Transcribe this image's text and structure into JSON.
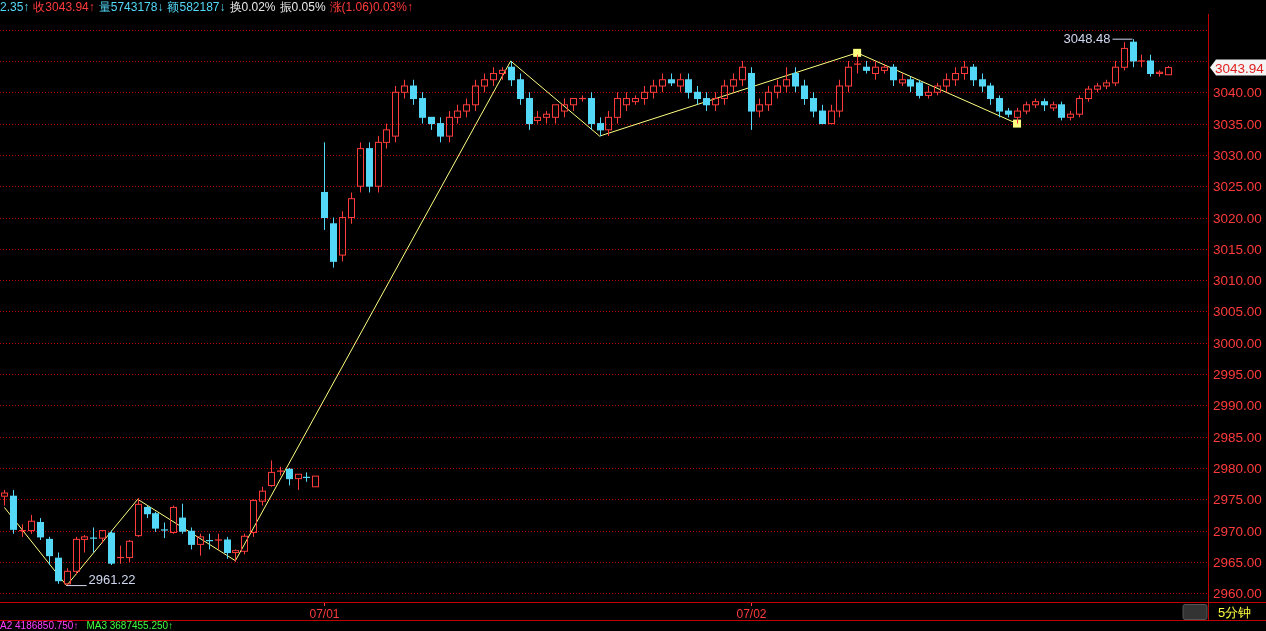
{
  "quote_bar": [
    {
      "text": "2.35↑",
      "color": "#54d8f8"
    },
    {
      "text": "收3043.94↑",
      "color": "#ff3b3b"
    },
    {
      "text": "量5743178↓",
      "color": "#54d8f8"
    },
    {
      "text": "额582187↓",
      "color": "#54d8f8"
    },
    {
      "text": "换0.02%",
      "color": "#e8e8e8"
    },
    {
      "text": "振0.05%",
      "color": "#e8e8e8"
    },
    {
      "text": "涨(1.06)0.03%↑",
      "color": "#ff3b3b"
    }
  ],
  "chart": {
    "period": "5分钟",
    "chart_data": {
      "type": "candlestick",
      "grid": true,
      "categories": [
        null,
        null,
        null,
        null,
        null,
        null,
        null,
        null,
        null,
        null,
        null,
        null,
        null,
        null,
        null,
        null,
        null,
        null,
        null,
        null,
        null,
        null,
        null,
        null,
        null,
        null,
        null,
        null,
        null,
        null,
        null,
        null,
        null,
        null,
        null,
        null,
        "07/01",
        null,
        null,
        null,
        null,
        null,
        null,
        null,
        null,
        null,
        null,
        null,
        null,
        null,
        null,
        null,
        null,
        null,
        null,
        null,
        null,
        null,
        null,
        null,
        null,
        null,
        null,
        null,
        null,
        null,
        null,
        null,
        null,
        null,
        null,
        null,
        null,
        null,
        null,
        null,
        null,
        null,
        null,
        null,
        null,
        null,
        null,
        null,
        "07/02",
        null,
        null,
        null,
        null,
        null,
        null,
        null,
        null,
        null,
        null,
        null,
        null,
        null,
        null,
        null,
        null,
        null,
        null,
        null,
        null,
        null,
        null,
        null,
        null,
        null,
        null,
        null,
        null,
        null,
        null,
        null,
        null,
        null,
        null,
        null,
        null,
        null,
        null,
        null,
        null,
        null,
        null,
        null,
        null,
        null,
        null,
        null,
        null,
        null,
        null,
        null
      ],
      "ylim": [
        2958.6,
        3052.5
      ],
      "yticks": [
        {
          "value": 3040,
          "label": "3040.00"
        },
        {
          "value": 3035,
          "label": "3035.00"
        },
        {
          "value": 3030,
          "label": "3030.00"
        },
        {
          "value": 3025,
          "label": "3025.00"
        },
        {
          "value": 3020,
          "label": "3020.00"
        },
        {
          "value": 3015,
          "label": "3015.00"
        },
        {
          "value": 3010,
          "label": "3010.00"
        },
        {
          "value": 3005,
          "label": "3005.00"
        },
        {
          "value": 3000,
          "label": "3000.00"
        },
        {
          "value": 2995,
          "label": "2995.00"
        },
        {
          "value": 2990,
          "label": "2990.00"
        },
        {
          "value": 2985,
          "label": "2985.00"
        },
        {
          "value": 2980,
          "label": "2980.00"
        },
        {
          "value": 2975,
          "label": "2975.00"
        },
        {
          "value": 2970,
          "label": "2970.00"
        },
        {
          "value": 2965,
          "label": "2965.00"
        },
        {
          "value": 2960,
          "label": "2960.00"
        }
      ],
      "ohlc": [
        [
          2975.5,
          2976.5,
          2974,
          2976
        ],
        [
          2975.5,
          2976.5,
          2969.5,
          2970.2
        ],
        [
          2970,
          2971,
          2969,
          2970
        ],
        [
          2970,
          2972.5,
          2969.5,
          2971.5
        ],
        [
          2971.3,
          2972,
          2968.5,
          2969
        ],
        [
          2968.6,
          2969,
          2964.5,
          2966
        ],
        [
          2965.6,
          2966.5,
          2961.5,
          2962
        ],
        [
          2961.5,
          2964,
          2961.22,
          2963.5
        ],
        [
          2963.5,
          2969,
          2963,
          2968.6
        ],
        [
          2968.6,
          2969.3,
          2966.5,
          2969
        ],
        [
          2968.8,
          2970.5,
          2966.5,
          2968.7
        ],
        [
          2968.8,
          2970,
          2968,
          2970
        ],
        [
          2969.6,
          2970,
          2964.5,
          2964.8
        ],
        [
          2965.7,
          2967.6,
          2964.7,
          2965.7
        ],
        [
          2965.7,
          2968.5,
          2965,
          2968.3
        ],
        [
          2969.2,
          2975.2,
          2969,
          2974.2
        ],
        [
          2973.7,
          2974,
          2972,
          2972.7
        ],
        [
          2972.7,
          2973,
          2969.8,
          2970.4
        ],
        [
          2970.1,
          2971.3,
          2968.8,
          2970
        ],
        [
          2969.7,
          2974,
          2969.5,
          2973.7
        ],
        [
          2972,
          2974.3,
          2969.5,
          2969.9
        ],
        [
          2969.9,
          2970.5,
          2967,
          2967.8
        ],
        [
          2967.8,
          2969.5,
          2966,
          2969
        ],
        [
          2968.4,
          2969.5,
          2967,
          2968.3
        ],
        [
          2968.5,
          2969.5,
          2967,
          2968.5
        ],
        [
          2968.5,
          2969,
          2965.5,
          2966.5
        ],
        [
          2966.5,
          2967,
          2965,
          2966.8
        ],
        [
          2966.7,
          2969.5,
          2966.2,
          2969.1
        ],
        [
          2969.7,
          2975,
          2969,
          2974.8
        ],
        [
          2974.7,
          2977,
          2974,
          2976.3
        ],
        [
          2977.2,
          2981.2,
          2977,
          2979.3
        ],
        [
          2979.5,
          2980.2,
          2978.8,
          2979.5
        ],
        [
          2979.8,
          2980,
          2977.2,
          2978.3
        ],
        [
          2978.3,
          2979,
          2976.5,
          2979
        ],
        [
          2978.5,
          2979.3,
          2977.8,
          2978.4
        ],
        [
          2977,
          2978.7,
          2977,
          2978.7
        ],
        [
          3024,
          3032,
          3018,
          3020
        ],
        [
          3019,
          3020,
          3012,
          3013
        ],
        [
          3014,
          3021,
          3013,
          3020
        ],
        [
          3020,
          3024,
          3019,
          3023
        ],
        [
          3025,
          3032,
          3024,
          3031
        ],
        [
          3031,
          3032,
          3024,
          3025
        ],
        [
          3025,
          3033,
          3024,
          3032
        ],
        [
          3032,
          3035,
          3031,
          3034
        ],
        [
          3033,
          3041,
          3032,
          3040
        ],
        [
          3040,
          3042,
          3039,
          3041
        ],
        [
          3041,
          3042,
          3038,
          3039
        ],
        [
          3039,
          3040,
          3035,
          3036
        ],
        [
          3036,
          3036,
          3034,
          3035
        ],
        [
          3035,
          3036,
          3032,
          3033
        ],
        [
          3033,
          3037,
          3032,
          3036
        ],
        [
          3036,
          3038,
          3035,
          3037
        ],
        [
          3037,
          3039,
          3036,
          3038
        ],
        [
          3038,
          3042,
          3037,
          3041
        ],
        [
          3041,
          3043,
          3040,
          3042
        ],
        [
          3042,
          3044,
          3041,
          3043
        ],
        [
          3043,
          3044,
          3042,
          3043.5
        ],
        [
          3044,
          3045,
          3041,
          3042
        ],
        [
          3042,
          3043,
          3038,
          3039
        ],
        [
          3039,
          3040,
          3034,
          3035
        ],
        [
          3035.5,
          3037,
          3035,
          3036
        ],
        [
          3036,
          3037,
          3035,
          3036.5
        ],
        [
          3036,
          3038,
          3035,
          3038
        ],
        [
          3037,
          3039,
          3036,
          3038
        ],
        [
          3038,
          3039,
          3037,
          3039
        ],
        [
          3039,
          3039.5,
          3038.5,
          3039
        ],
        [
          3039,
          3040,
          3034,
          3035
        ],
        [
          3035,
          3036,
          3033,
          3034
        ],
        [
          3034,
          3037,
          3033,
          3036
        ],
        [
          3036,
          3040,
          3035,
          3039
        ],
        [
          3038,
          3040,
          3037,
          3039
        ],
        [
          3038.5,
          3039.5,
          3038,
          3039
        ],
        [
          3039,
          3041,
          3038,
          3040
        ],
        [
          3040,
          3042,
          3039,
          3041
        ],
        [
          3041,
          3043,
          3040,
          3042
        ],
        [
          3042,
          3043,
          3041,
          3041.5
        ],
        [
          3041,
          3043,
          3040,
          3042
        ],
        [
          3042,
          3043,
          3039,
          3040
        ],
        [
          3040,
          3041,
          3038,
          3039
        ],
        [
          3039,
          3040,
          3037,
          3038
        ],
        [
          3038,
          3040,
          3037,
          3039
        ],
        [
          3039,
          3042,
          3038,
          3041
        ],
        [
          3041,
          3043,
          3040,
          3042
        ],
        [
          3042,
          3045,
          3041,
          3044
        ],
        [
          3043,
          3044,
          3034,
          3037
        ],
        [
          3037,
          3039,
          3036,
          3038
        ],
        [
          3038,
          3041,
          3037,
          3040
        ],
        [
          3040,
          3042,
          3039,
          3041
        ],
        [
          3041,
          3044,
          3040,
          3042
        ],
        [
          3043,
          3044,
          3040,
          3041
        ],
        [
          3041,
          3042,
          3038,
          3039
        ],
        [
          3039,
          3040,
          3036,
          3037
        ],
        [
          3037,
          3038,
          3035,
          3035
        ],
        [
          3035,
          3038,
          3035,
          3037
        ],
        [
          3037,
          3042,
          3036,
          3041
        ],
        [
          3041,
          3045,
          3040,
          3044
        ],
        [
          3044.5,
          3046,
          3043,
          3044.5
        ],
        [
          3044,
          3045,
          3043,
          3043.5
        ],
        [
          3043,
          3045,
          3042,
          3044
        ],
        [
          3043.5,
          3044.5,
          3043,
          3044
        ],
        [
          3044,
          3044.5,
          3041,
          3042
        ],
        [
          3041.5,
          3043,
          3041,
          3042
        ],
        [
          3042,
          3042.5,
          3040,
          3041
        ],
        [
          3041.5,
          3042,
          3039,
          3039.5
        ],
        [
          3039.5,
          3041,
          3039,
          3040
        ],
        [
          3040,
          3041.5,
          3039.5,
          3041
        ],
        [
          3041,
          3043,
          3040,
          3042
        ],
        [
          3042,
          3044,
          3041,
          3043
        ],
        [
          3043,
          3045,
          3042,
          3044
        ],
        [
          3044,
          3044.5,
          3041,
          3042
        ],
        [
          3042,
          3043,
          3040,
          3041
        ],
        [
          3041,
          3041.5,
          3038,
          3039
        ],
        [
          3039,
          3039.5,
          3036,
          3037
        ],
        [
          3037,
          3037.5,
          3036,
          3036.5
        ],
        [
          3036,
          3037.5,
          3035,
          3037
        ],
        [
          3037,
          3038.5,
          3036.5,
          3038
        ],
        [
          3038,
          3039,
          3037.5,
          3038.5
        ],
        [
          3038.5,
          3039,
          3037,
          3038
        ],
        [
          3037.5,
          3038.5,
          3037,
          3038
        ],
        [
          3038,
          3038.5,
          3035.5,
          3036
        ],
        [
          3036,
          3037,
          3035.5,
          3036.5
        ],
        [
          3036.5,
          3039.5,
          3036,
          3039
        ],
        [
          3039,
          3041,
          3038.5,
          3040.5
        ],
        [
          3040.5,
          3041.5,
          3040,
          3041
        ],
        [
          3041,
          3042,
          3040.5,
          3041.5
        ],
        [
          3041.5,
          3045,
          3041,
          3044
        ],
        [
          3044,
          3048,
          3043.5,
          3047
        ],
        [
          3048,
          3048.48,
          3044,
          3045
        ],
        [
          3045,
          3046,
          3044,
          3045
        ],
        [
          3045,
          3046,
          3042.5,
          3043
        ],
        [
          3043,
          3043.5,
          3042.5,
          3043.2
        ],
        [
          3042.8,
          3044.2,
          3042.8,
          3043.94
        ],
        null,
        null,
        null,
        null
      ],
      "series": [
        {
          "type": "line",
          "color": "#ffff80",
          "values": [
            2973.7,
            null,
            null,
            null,
            null,
            null,
            null,
            2961.22,
            null,
            null,
            null,
            null,
            null,
            null,
            null,
            2975,
            null,
            null,
            null,
            null,
            null,
            null,
            null,
            null,
            null,
            null,
            2965.2,
            null,
            null,
            null,
            null,
            null,
            null,
            null,
            null,
            null,
            null,
            null,
            null,
            null,
            null,
            null,
            null,
            null,
            null,
            null,
            null,
            null,
            null,
            null,
            null,
            null,
            null,
            null,
            null,
            null,
            null,
            3045,
            null,
            null,
            null,
            null,
            null,
            null,
            null,
            null,
            null,
            3033,
            null,
            null,
            null,
            null,
            null,
            null,
            null,
            null,
            null,
            null,
            null,
            null,
            null,
            null,
            null,
            null,
            null,
            null,
            null,
            null,
            null,
            null,
            null,
            null,
            null,
            null,
            null,
            null,
            3046.3,
            null,
            null,
            null,
            null,
            null,
            null,
            null,
            null,
            null,
            null,
            null,
            null,
            null,
            null,
            null,
            null,
            null,
            3035,
            null,
            null,
            null,
            null,
            null,
            null,
            null,
            null,
            null,
            null,
            null,
            null,
            null,
            null,
            null,
            null,
            null,
            null,
            null,
            null,
            null
          ]
        }
      ],
      "annotations": [
        "2961.22",
        "3048.48",
        "3043.94"
      ]
    }
  },
  "indicators": [
    {
      "text": "A2 4186850.750↑",
      "color": "#ff40ff"
    },
    {
      "text": "MA3 3687455.250↑",
      "color": "#40ff40"
    }
  ]
}
